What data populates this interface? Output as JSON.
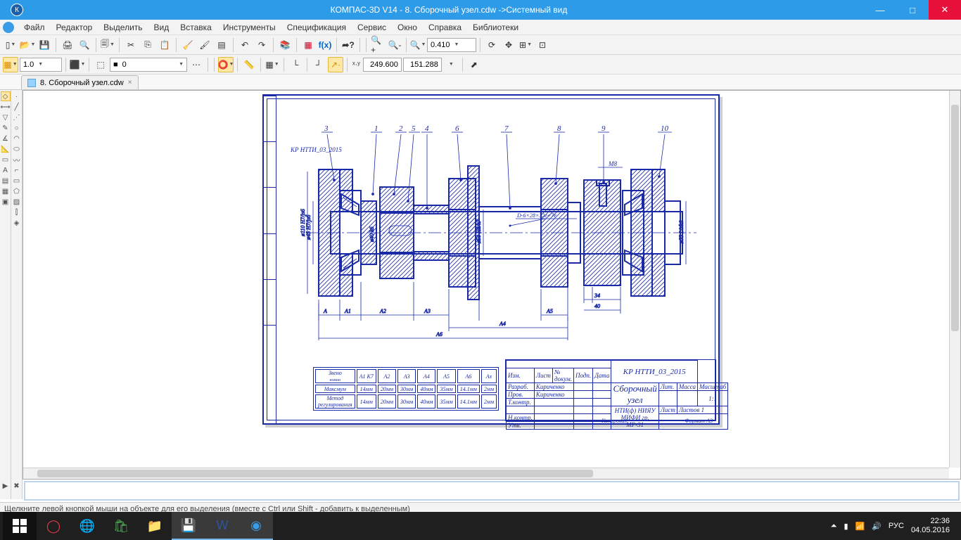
{
  "title": "КОМПАС-3D V14 - 8. Сборочный узел.cdw ->Системный вид",
  "menu": [
    "Файл",
    "Редактор",
    "Выделить",
    "Вид",
    "Вставка",
    "Инструменты",
    "Спецификация",
    "Сервис",
    "Окно",
    "Справка",
    "Библиотеки"
  ],
  "zoom_value": "0.410",
  "tb2_num": "1.0",
  "tb2_layer": "0",
  "coord_x": "249.600",
  "coord_y": "151.288",
  "doc_tab": "8. Сборочный узел.cdw",
  "status": "Щелкните левой кнопкой мыши на объекте для его выделения (вместе с Ctrl или Shift - добавить к выделенным)",
  "tray_lang": "РУС",
  "tray_time": "22:36",
  "tray_date": "04.05.2016",
  "drawing": {
    "code_top": "КР НТТИ_03_2015",
    "balloons": [
      "3",
      "1",
      "2",
      "5",
      "4",
      "6",
      "7",
      "8",
      "9",
      "10"
    ],
    "callout_m8": "M8",
    "callout_spline": "D-6×28×32e+7e",
    "dim_34": "34",
    "dim_40": "40",
    "dim_A": "A",
    "dim_A1": "A1",
    "dim_A2": "A2",
    "dim_A3": "A3",
    "dim_A4": "A4",
    "dim_A5": "A5",
    "dim_A6": "A6",
    "diam1": "ø110 H7/js6",
    "diam2": "ø45 H7/js6",
    "diam3": "ø40 k6",
    "diam4": "ø50 H8/k7",
    "diam5": "ø55 L0/k6",
    "table": {
      "header": [
        "Звено",
        "А1 К7",
        "А2",
        "А3",
        "А4",
        "А5",
        "А6",
        "Аx"
      ],
      "rows": [
        [
          "Максмум",
          "14мм",
          "20мм",
          "30мм",
          "40мм",
          "35мм",
          "14.1мм",
          "2мм"
        ],
        [
          "Метод регулирования",
          "14мм",
          "20мм",
          "30мм",
          "40мм",
          "35мм",
          "14.1мм",
          "2мм"
        ]
      ]
    },
    "titleblock": {
      "code": "КР НТТИ_03_2015",
      "name": "Сборочный узел",
      "scale": "1:1",
      "org": "НТИ(ф) НИЯУ МИФИ гр. МР-31",
      "format": "Формат    A3",
      "devel": "Разраб.",
      "prov": "Пров.",
      "tkontr": "Т.контр.",
      "nkontr": "Н.контр.",
      "utv": "Утв.",
      "surname1": "Кириченко",
      "surname2": "Кириченко",
      "izm": "Изм.",
      "list": "Лист",
      "nodok": "№ докум.",
      "podp": "Подп.",
      "data": "Дата",
      "lit": "Лит.",
      "massa": "Масса",
      "masshtab": "Масштаб",
      "listn": "Лист",
      "listov": "Листов 1",
      "kopir": "Копировал"
    }
  }
}
